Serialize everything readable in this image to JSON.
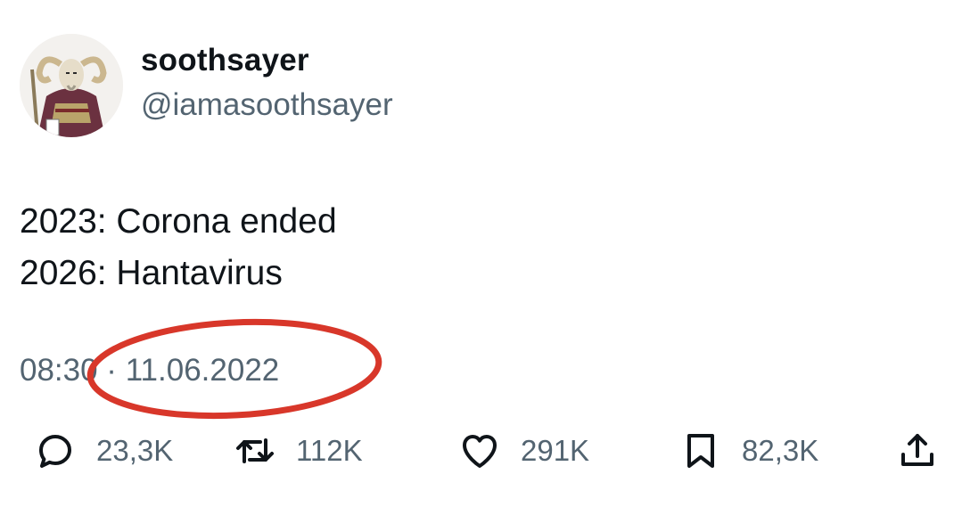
{
  "author": {
    "display_name": "soothsayer",
    "handle": "@iamasoothsayer",
    "avatar_icon": "goat-soothsayer-avatar"
  },
  "tweet": {
    "lines": [
      "2023: Corona ended",
      "2026: Hantavirus"
    ]
  },
  "meta": {
    "timestamp": "08:30 · 11.06.2022"
  },
  "annotation": {
    "oval_color": "#d8372a"
  },
  "actions": {
    "reply": {
      "icon": "reply-icon",
      "count": "23,3K"
    },
    "retweet": {
      "icon": "retweet-icon",
      "count": "112K"
    },
    "like": {
      "icon": "heart-icon",
      "count": "291K"
    },
    "bookmark": {
      "icon": "bookmark-icon",
      "count": "82,3K"
    },
    "share": {
      "icon": "share-icon"
    }
  },
  "colors": {
    "text": "#0f1419",
    "secondary": "#536471"
  }
}
